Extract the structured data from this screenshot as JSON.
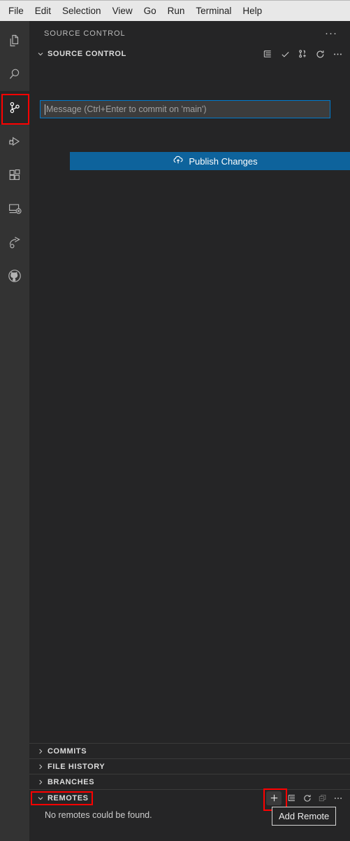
{
  "menubar": {
    "items": [
      {
        "label": "File"
      },
      {
        "label": "Edit"
      },
      {
        "label": "Selection"
      },
      {
        "label": "View"
      },
      {
        "label": "Go"
      },
      {
        "label": "Run"
      },
      {
        "label": "Terminal"
      },
      {
        "label": "Help"
      }
    ]
  },
  "activitybar": {
    "items": [
      {
        "name": "explorer",
        "icon": "files-icon",
        "active": false
      },
      {
        "name": "search",
        "icon": "search-icon",
        "active": false
      },
      {
        "name": "source-control",
        "icon": "source-control-icon",
        "active": true
      },
      {
        "name": "run-and-debug",
        "icon": "run-debug-icon",
        "active": false
      },
      {
        "name": "extensions",
        "icon": "extensions-icon",
        "active": false
      },
      {
        "name": "remote-explorer",
        "icon": "remote-explorer-icon",
        "active": false
      },
      {
        "name": "live-share",
        "icon": "live-share-icon",
        "active": false
      },
      {
        "name": "github",
        "icon": "github-icon",
        "active": false
      }
    ]
  },
  "sidebar": {
    "title": "SOURCE CONTROL",
    "more_actions": "···",
    "scm": {
      "section_label": "SOURCE CONTROL",
      "toolbar": [
        {
          "name": "view-as-list-icon",
          "title": "View as List"
        },
        {
          "name": "check-icon",
          "title": "Commit"
        },
        {
          "name": "git-branch-add-icon",
          "title": "Source Control Actions"
        },
        {
          "name": "refresh-icon",
          "title": "Refresh"
        },
        {
          "name": "more-actions-icon",
          "title": "Views and More Actions"
        }
      ],
      "commit_input": {
        "value": "",
        "placeholder": "Message (Ctrl+Enter to commit on 'main')"
      },
      "publish_button": {
        "label": "Publish Changes",
        "icon": "cloud-upload-icon"
      }
    },
    "sections": [
      {
        "label": "COMMITS",
        "expanded": false
      },
      {
        "label": "FILE HISTORY",
        "expanded": false
      },
      {
        "label": "BRANCHES",
        "expanded": false
      }
    ],
    "remotes": {
      "label": "REMOTES",
      "expanded": true,
      "empty_message": "No remotes could be found.",
      "toolbar": [
        {
          "name": "add-remote-icon",
          "title": "Add Remote",
          "highlighted": true
        },
        {
          "name": "view-as-list-icon",
          "title": "View as List"
        },
        {
          "name": "refresh-icon",
          "title": "Refresh"
        },
        {
          "name": "collapse-all-icon",
          "title": "Collapse All",
          "disabled": true
        },
        {
          "name": "more-actions-icon",
          "title": "Views and More Actions"
        }
      ]
    }
  },
  "tooltip": {
    "text": "Add Remote"
  },
  "colors": {
    "menubar_background": "#e8e8e8",
    "activitybar_background": "#333333",
    "sidebar_background": "#252526",
    "accent_blue": "#007acc",
    "button_blue": "#0e639c",
    "highlight_red": "#ff0000",
    "text_primary": "#cccccc"
  }
}
